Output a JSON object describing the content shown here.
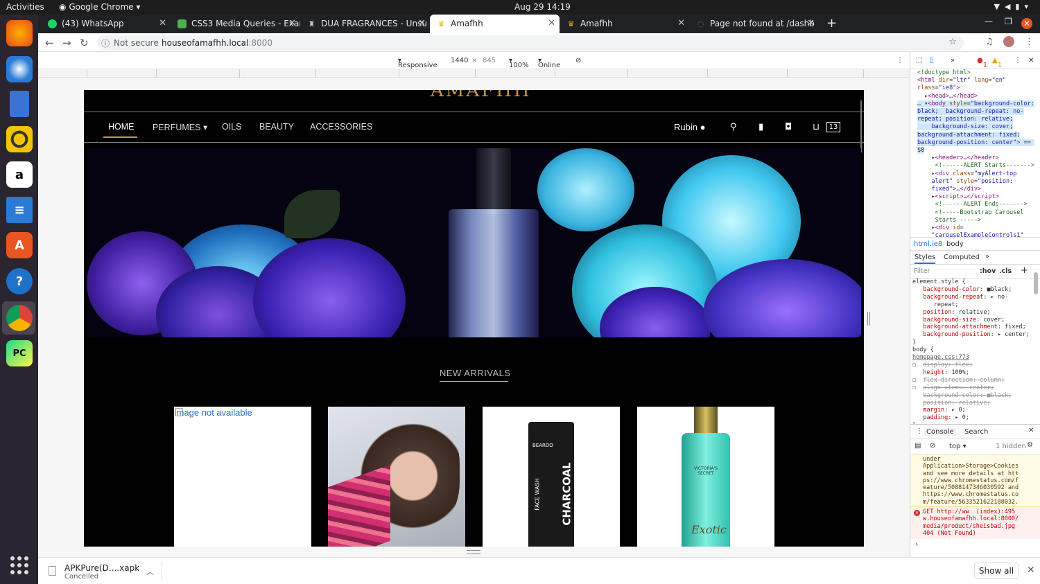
{
  "os": {
    "activities": "Activities",
    "app_name": "Google Chrome",
    "clock": "Aug 29  14:19"
  },
  "tabs": [
    {
      "label": "(43) WhatsApp"
    },
    {
      "label": "CSS3 Media Queries - Exar"
    },
    {
      "label": "DUA FRAGRANCES - Unsu"
    },
    {
      "label": "Amafhh"
    },
    {
      "label": "Amafhh"
    },
    {
      "label": "Page not found at /dashb"
    }
  ],
  "address": {
    "security": "Not secure",
    "host": "houseofamafhh.local",
    "port": ":8000"
  },
  "device_toolbar": {
    "mode": "Responsive",
    "width": "1440",
    "times": "×",
    "height": "845",
    "zoom": "100%",
    "network": "Online"
  },
  "site": {
    "logo": "AMAFHH",
    "nav": [
      "HOME",
      "PERFUMES",
      "OILS",
      "BEAUTY",
      "ACCESSORIES"
    ],
    "user": "Rubin",
    "cart_count": "13",
    "section_title": "NEW ARRIVALS",
    "missing_image_alt": "Image not available",
    "product_labels": {
      "beardo_brand": "BEARDO",
      "beardo_type": "FACE WASH",
      "beardo_name": "CHARCOAL",
      "vs_brand": "VICTORIA'S SECRET",
      "vs_name": "Exotic"
    }
  },
  "devtools": {
    "errors": "1",
    "warnings": "1",
    "breadcrumb": [
      "html.ie8",
      "body"
    ],
    "style_tabs": [
      "Styles",
      "Computed"
    ],
    "filter_placeholder": "Filter",
    "hov": ":hov",
    "cls": ".cls",
    "css_source": "homepage.css:773",
    "console_tabs": [
      "Console",
      "Search"
    ],
    "context": "top",
    "hidden": "1 hidden",
    "warning_text": "under\nApplication>Storage>Cookies\nand see more details at htt\nps://www.chromestatus.com/f\neature/5088147346030592 and\nhttps://www.chromestatus.co\nm/feature/5633521622188032.",
    "error_text": "GET http://ww  (index):495\nw.houseofamafhh.local:8000/\nmedia/product/sheisbad.jpg\n404 (Not Found)"
  },
  "download": {
    "name": "APKPure(D....xapk",
    "status": "Cancelled",
    "show_all": "Show all"
  }
}
